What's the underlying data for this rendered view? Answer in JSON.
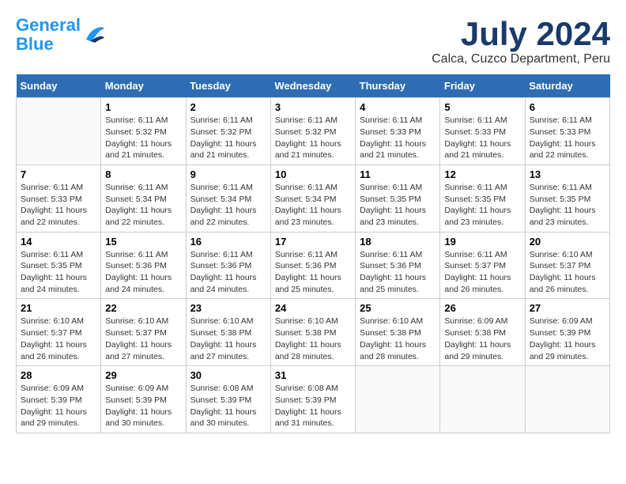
{
  "header": {
    "logo_line1": "General",
    "logo_line2": "Blue",
    "month_year": "July 2024",
    "location": "Calca, Cuzco Department, Peru"
  },
  "weekdays": [
    "Sunday",
    "Monday",
    "Tuesday",
    "Wednesday",
    "Thursday",
    "Friday",
    "Saturday"
  ],
  "weeks": [
    [
      {
        "day": "",
        "info": ""
      },
      {
        "day": "1",
        "info": "Sunrise: 6:11 AM\nSunset: 5:32 PM\nDaylight: 11 hours\nand 21 minutes."
      },
      {
        "day": "2",
        "info": "Sunrise: 6:11 AM\nSunset: 5:32 PM\nDaylight: 11 hours\nand 21 minutes."
      },
      {
        "day": "3",
        "info": "Sunrise: 6:11 AM\nSunset: 5:32 PM\nDaylight: 11 hours\nand 21 minutes."
      },
      {
        "day": "4",
        "info": "Sunrise: 6:11 AM\nSunset: 5:33 PM\nDaylight: 11 hours\nand 21 minutes."
      },
      {
        "day": "5",
        "info": "Sunrise: 6:11 AM\nSunset: 5:33 PM\nDaylight: 11 hours\nand 21 minutes."
      },
      {
        "day": "6",
        "info": "Sunrise: 6:11 AM\nSunset: 5:33 PM\nDaylight: 11 hours\nand 22 minutes."
      }
    ],
    [
      {
        "day": "7",
        "info": "Sunrise: 6:11 AM\nSunset: 5:33 PM\nDaylight: 11 hours\nand 22 minutes."
      },
      {
        "day": "8",
        "info": "Sunrise: 6:11 AM\nSunset: 5:34 PM\nDaylight: 11 hours\nand 22 minutes."
      },
      {
        "day": "9",
        "info": "Sunrise: 6:11 AM\nSunset: 5:34 PM\nDaylight: 11 hours\nand 22 minutes."
      },
      {
        "day": "10",
        "info": "Sunrise: 6:11 AM\nSunset: 5:34 PM\nDaylight: 11 hours\nand 23 minutes."
      },
      {
        "day": "11",
        "info": "Sunrise: 6:11 AM\nSunset: 5:35 PM\nDaylight: 11 hours\nand 23 minutes."
      },
      {
        "day": "12",
        "info": "Sunrise: 6:11 AM\nSunset: 5:35 PM\nDaylight: 11 hours\nand 23 minutes."
      },
      {
        "day": "13",
        "info": "Sunrise: 6:11 AM\nSunset: 5:35 PM\nDaylight: 11 hours\nand 23 minutes."
      }
    ],
    [
      {
        "day": "14",
        "info": "Sunrise: 6:11 AM\nSunset: 5:35 PM\nDaylight: 11 hours\nand 24 minutes."
      },
      {
        "day": "15",
        "info": "Sunrise: 6:11 AM\nSunset: 5:36 PM\nDaylight: 11 hours\nand 24 minutes."
      },
      {
        "day": "16",
        "info": "Sunrise: 6:11 AM\nSunset: 5:36 PM\nDaylight: 11 hours\nand 24 minutes."
      },
      {
        "day": "17",
        "info": "Sunrise: 6:11 AM\nSunset: 5:36 PM\nDaylight: 11 hours\nand 25 minutes."
      },
      {
        "day": "18",
        "info": "Sunrise: 6:11 AM\nSunset: 5:36 PM\nDaylight: 11 hours\nand 25 minutes."
      },
      {
        "day": "19",
        "info": "Sunrise: 6:11 AM\nSunset: 5:37 PM\nDaylight: 11 hours\nand 26 minutes."
      },
      {
        "day": "20",
        "info": "Sunrise: 6:10 AM\nSunset: 5:37 PM\nDaylight: 11 hours\nand 26 minutes."
      }
    ],
    [
      {
        "day": "21",
        "info": "Sunrise: 6:10 AM\nSunset: 5:37 PM\nDaylight: 11 hours\nand 26 minutes."
      },
      {
        "day": "22",
        "info": "Sunrise: 6:10 AM\nSunset: 5:37 PM\nDaylight: 11 hours\nand 27 minutes."
      },
      {
        "day": "23",
        "info": "Sunrise: 6:10 AM\nSunset: 5:38 PM\nDaylight: 11 hours\nand 27 minutes."
      },
      {
        "day": "24",
        "info": "Sunrise: 6:10 AM\nSunset: 5:38 PM\nDaylight: 11 hours\nand 28 minutes."
      },
      {
        "day": "25",
        "info": "Sunrise: 6:10 AM\nSunset: 5:38 PM\nDaylight: 11 hours\nand 28 minutes."
      },
      {
        "day": "26",
        "info": "Sunrise: 6:09 AM\nSunset: 5:38 PM\nDaylight: 11 hours\nand 29 minutes."
      },
      {
        "day": "27",
        "info": "Sunrise: 6:09 AM\nSunset: 5:39 PM\nDaylight: 11 hours\nand 29 minutes."
      }
    ],
    [
      {
        "day": "28",
        "info": "Sunrise: 6:09 AM\nSunset: 5:39 PM\nDaylight: 11 hours\nand 29 minutes."
      },
      {
        "day": "29",
        "info": "Sunrise: 6:09 AM\nSunset: 5:39 PM\nDaylight: 11 hours\nand 30 minutes."
      },
      {
        "day": "30",
        "info": "Sunrise: 6:08 AM\nSunset: 5:39 PM\nDaylight: 11 hours\nand 30 minutes."
      },
      {
        "day": "31",
        "info": "Sunrise: 6:08 AM\nSunset: 5:39 PM\nDaylight: 11 hours\nand 31 minutes."
      },
      {
        "day": "",
        "info": ""
      },
      {
        "day": "",
        "info": ""
      },
      {
        "day": "",
        "info": ""
      }
    ]
  ]
}
